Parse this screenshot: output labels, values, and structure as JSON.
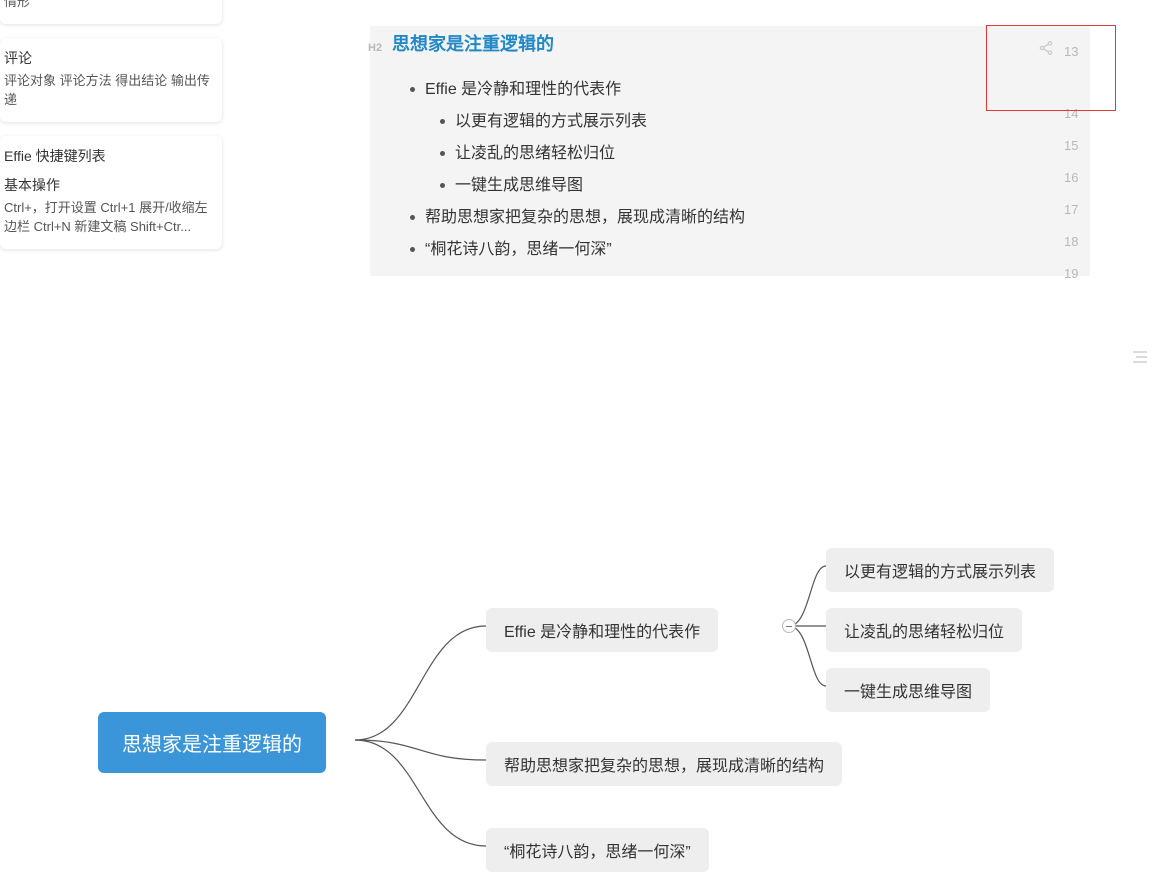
{
  "sidebar": {
    "card0": {
      "snippet": "情形"
    },
    "card1": {
      "title": "评论",
      "body": "评论对象 评论方法 得出结论 输出传递"
    },
    "card2": {
      "title": "Effie 快捷键列表",
      "sub": "基本操作",
      "body": "Ctrl+，打开设置 Ctrl+1 展开/收缩左边栏 Ctrl+N 新建文稿 Shift+Ctr..."
    }
  },
  "editor": {
    "h2_tag": "H2",
    "title": "思想家是注重逻辑的",
    "bullets": [
      {
        "level": 1,
        "text": "Effie 是冷静和理性的代表作"
      },
      {
        "level": 2,
        "text": "以更有逻辑的方式展示列表"
      },
      {
        "level": 2,
        "text": "让凌乱的思绪轻松归位"
      },
      {
        "level": 2,
        "text": "一键生成思维导图"
      },
      {
        "level": 1,
        "text": "帮助思想家把复杂的思想，展现成清晰的结构"
      },
      {
        "level": 1,
        "text": "“桐花诗八韵，思绪一何深”"
      }
    ],
    "line_numbers": [
      "13",
      "14",
      "15",
      "16",
      "17",
      "18",
      "19"
    ]
  },
  "mindmap": {
    "root": "思想家是注重逻辑的",
    "children": [
      {
        "text": "Effie 是冷静和理性的代表作",
        "children": [
          {
            "text": "以更有逻辑的方式展示列表"
          },
          {
            "text": "让凌乱的思绪轻松归位"
          },
          {
            "text": "一键生成思维导图"
          }
        ]
      },
      {
        "text": "帮助思想家把复杂的思想，展现成清晰的结构"
      },
      {
        "text": "“桐花诗八韵，思绪一何深”"
      }
    ]
  }
}
